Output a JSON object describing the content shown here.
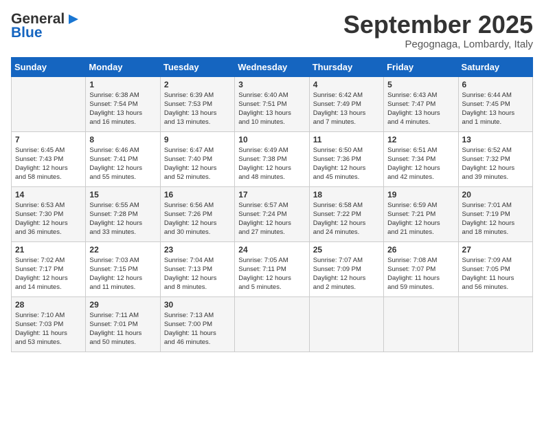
{
  "header": {
    "logo_general": "General",
    "logo_blue": "Blue",
    "month_title": "September 2025",
    "location": "Pegognaga, Lombardy, Italy"
  },
  "days_of_week": [
    "Sunday",
    "Monday",
    "Tuesday",
    "Wednesday",
    "Thursday",
    "Friday",
    "Saturday"
  ],
  "weeks": [
    [
      {
        "day": "",
        "content": ""
      },
      {
        "day": "1",
        "content": "Sunrise: 6:38 AM\nSunset: 7:54 PM\nDaylight: 13 hours\nand 16 minutes."
      },
      {
        "day": "2",
        "content": "Sunrise: 6:39 AM\nSunset: 7:53 PM\nDaylight: 13 hours\nand 13 minutes."
      },
      {
        "day": "3",
        "content": "Sunrise: 6:40 AM\nSunset: 7:51 PM\nDaylight: 13 hours\nand 10 minutes."
      },
      {
        "day": "4",
        "content": "Sunrise: 6:42 AM\nSunset: 7:49 PM\nDaylight: 13 hours\nand 7 minutes."
      },
      {
        "day": "5",
        "content": "Sunrise: 6:43 AM\nSunset: 7:47 PM\nDaylight: 13 hours\nand 4 minutes."
      },
      {
        "day": "6",
        "content": "Sunrise: 6:44 AM\nSunset: 7:45 PM\nDaylight: 13 hours\nand 1 minute."
      }
    ],
    [
      {
        "day": "7",
        "content": "Sunrise: 6:45 AM\nSunset: 7:43 PM\nDaylight: 12 hours\nand 58 minutes."
      },
      {
        "day": "8",
        "content": "Sunrise: 6:46 AM\nSunset: 7:41 PM\nDaylight: 12 hours\nand 55 minutes."
      },
      {
        "day": "9",
        "content": "Sunrise: 6:47 AM\nSunset: 7:40 PM\nDaylight: 12 hours\nand 52 minutes."
      },
      {
        "day": "10",
        "content": "Sunrise: 6:49 AM\nSunset: 7:38 PM\nDaylight: 12 hours\nand 48 minutes."
      },
      {
        "day": "11",
        "content": "Sunrise: 6:50 AM\nSunset: 7:36 PM\nDaylight: 12 hours\nand 45 minutes."
      },
      {
        "day": "12",
        "content": "Sunrise: 6:51 AM\nSunset: 7:34 PM\nDaylight: 12 hours\nand 42 minutes."
      },
      {
        "day": "13",
        "content": "Sunrise: 6:52 AM\nSunset: 7:32 PM\nDaylight: 12 hours\nand 39 minutes."
      }
    ],
    [
      {
        "day": "14",
        "content": "Sunrise: 6:53 AM\nSunset: 7:30 PM\nDaylight: 12 hours\nand 36 minutes."
      },
      {
        "day": "15",
        "content": "Sunrise: 6:55 AM\nSunset: 7:28 PM\nDaylight: 12 hours\nand 33 minutes."
      },
      {
        "day": "16",
        "content": "Sunrise: 6:56 AM\nSunset: 7:26 PM\nDaylight: 12 hours\nand 30 minutes."
      },
      {
        "day": "17",
        "content": "Sunrise: 6:57 AM\nSunset: 7:24 PM\nDaylight: 12 hours\nand 27 minutes."
      },
      {
        "day": "18",
        "content": "Sunrise: 6:58 AM\nSunset: 7:22 PM\nDaylight: 12 hours\nand 24 minutes."
      },
      {
        "day": "19",
        "content": "Sunrise: 6:59 AM\nSunset: 7:21 PM\nDaylight: 12 hours\nand 21 minutes."
      },
      {
        "day": "20",
        "content": "Sunrise: 7:01 AM\nSunset: 7:19 PM\nDaylight: 12 hours\nand 18 minutes."
      }
    ],
    [
      {
        "day": "21",
        "content": "Sunrise: 7:02 AM\nSunset: 7:17 PM\nDaylight: 12 hours\nand 14 minutes."
      },
      {
        "day": "22",
        "content": "Sunrise: 7:03 AM\nSunset: 7:15 PM\nDaylight: 12 hours\nand 11 minutes."
      },
      {
        "day": "23",
        "content": "Sunrise: 7:04 AM\nSunset: 7:13 PM\nDaylight: 12 hours\nand 8 minutes."
      },
      {
        "day": "24",
        "content": "Sunrise: 7:05 AM\nSunset: 7:11 PM\nDaylight: 12 hours\nand 5 minutes."
      },
      {
        "day": "25",
        "content": "Sunrise: 7:07 AM\nSunset: 7:09 PM\nDaylight: 12 hours\nand 2 minutes."
      },
      {
        "day": "26",
        "content": "Sunrise: 7:08 AM\nSunset: 7:07 PM\nDaylight: 11 hours\nand 59 minutes."
      },
      {
        "day": "27",
        "content": "Sunrise: 7:09 AM\nSunset: 7:05 PM\nDaylight: 11 hours\nand 56 minutes."
      }
    ],
    [
      {
        "day": "28",
        "content": "Sunrise: 7:10 AM\nSunset: 7:03 PM\nDaylight: 11 hours\nand 53 minutes."
      },
      {
        "day": "29",
        "content": "Sunrise: 7:11 AM\nSunset: 7:01 PM\nDaylight: 11 hours\nand 50 minutes."
      },
      {
        "day": "30",
        "content": "Sunrise: 7:13 AM\nSunset: 7:00 PM\nDaylight: 11 hours\nand 46 minutes."
      },
      {
        "day": "",
        "content": ""
      },
      {
        "day": "",
        "content": ""
      },
      {
        "day": "",
        "content": ""
      },
      {
        "day": "",
        "content": ""
      }
    ]
  ]
}
